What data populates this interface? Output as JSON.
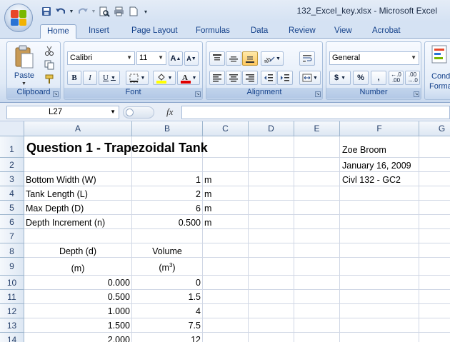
{
  "window": {
    "title": "132_Excel_key.xlsx - Microsoft Excel"
  },
  "ribbon": {
    "tabs": [
      "Home",
      "Insert",
      "Page Layout",
      "Formulas",
      "Data",
      "Review",
      "View",
      "Acrobat"
    ],
    "clipboard": {
      "label": "Clipboard",
      "paste_label": "Paste"
    },
    "font": {
      "label": "Font",
      "font_name": "Calibri",
      "font_size": "11",
      "grow": "A",
      "shrink": "A",
      "bold": "B",
      "italic": "I",
      "underline": "U"
    },
    "alignment": {
      "label": "Alignment"
    },
    "number": {
      "label": "Number",
      "format": "General",
      "currency": "$",
      "percent": "%",
      "comma": ",",
      "inc_decimal": "←.0 .00",
      "dec_decimal": ".00 →.0"
    },
    "styles": {
      "cond_label_1": "Cond",
      "cond_label_2": "Forma"
    }
  },
  "formula_bar": {
    "name_box": "L27",
    "fx": "fx",
    "value": ""
  },
  "sheet": {
    "columns": [
      "A",
      "B",
      "C",
      "D",
      "E",
      "F",
      "G"
    ],
    "rows": [
      "1",
      "2",
      "3",
      "4",
      "5",
      "6",
      "7",
      "8",
      "9",
      "10",
      "11",
      "12",
      "13",
      "14"
    ],
    "cells": {
      "A1": "Question 1 - Trapezoidal Tank",
      "F1": "Zoe Broom",
      "F2": "January 16, 2009",
      "A3": "Bottom Width (W)",
      "B3": "1",
      "C3": "m",
      "F3": "Civl 132 - GC2",
      "A4": "Tank Length (L)",
      "B4": "2",
      "C4": "m",
      "A5": "Max Depth (D)",
      "B5": "6",
      "C5": "m",
      "A6": "Depth Increment (n)",
      "B6": "0.500",
      "C6": "m",
      "A8": "Depth (d)",
      "B8": "Volume",
      "A9": "(m)",
      "B9": "(m",
      "B9_sup": "3",
      "B9_close": ")",
      "A10": "0.000",
      "B10": "0",
      "A11": "0.500",
      "B11": "1.5",
      "A12": "1.000",
      "B12": "4",
      "A13": "1.500",
      "B13": "7.5",
      "A14": "2.000",
      "B14": "12"
    }
  }
}
